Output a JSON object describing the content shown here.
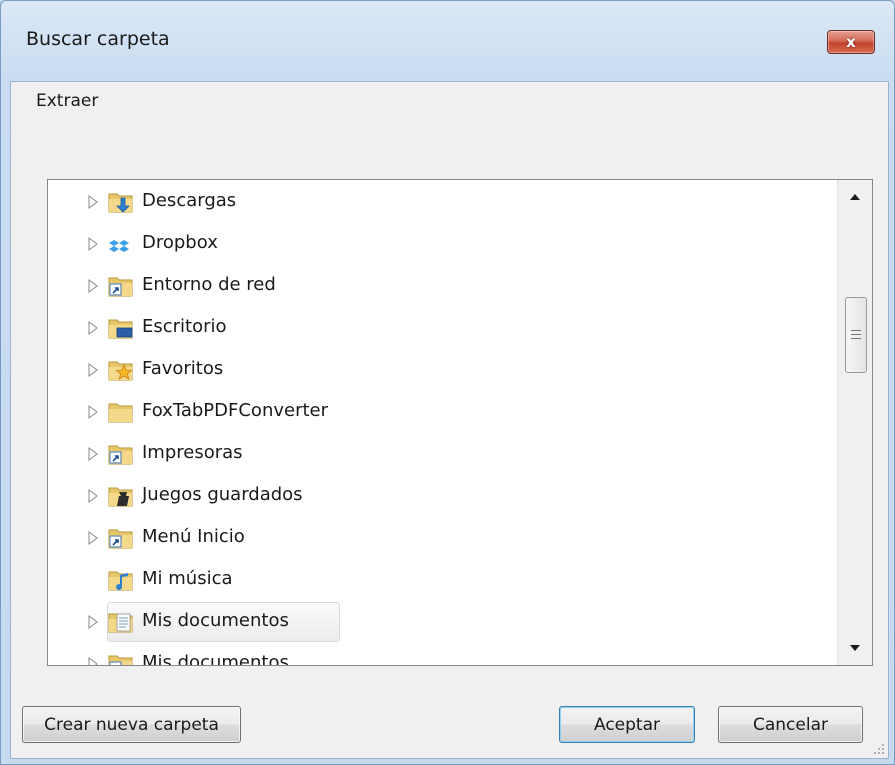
{
  "window": {
    "title": "Buscar carpeta",
    "close_label": "x"
  },
  "dialog": {
    "prompt": "Extraer"
  },
  "tree": {
    "items": [
      {
        "label": "Descargas",
        "icon": "downloads-folder-icon",
        "expandable": true
      },
      {
        "label": "Dropbox",
        "icon": "dropbox-folder-icon",
        "expandable": true
      },
      {
        "label": "Entorno de red",
        "icon": "shortcut-folder-icon",
        "expandable": true
      },
      {
        "label": "Escritorio",
        "icon": "desktop-folder-icon",
        "expandable": true
      },
      {
        "label": "Favoritos",
        "icon": "favorites-folder-icon",
        "expandable": true
      },
      {
        "label": "FoxTabPDFConverter",
        "icon": "folder-icon",
        "expandable": true
      },
      {
        "label": "Impresoras",
        "icon": "shortcut-folder-icon",
        "expandable": true
      },
      {
        "label": "Juegos guardados",
        "icon": "saved-games-folder-icon",
        "expandable": true
      },
      {
        "label": "Menú Inicio",
        "icon": "shortcut-folder-icon",
        "expandable": true
      },
      {
        "label": "Mi música",
        "icon": "music-folder-icon",
        "expandable": false
      },
      {
        "label": "Mis documentos",
        "icon": "documents-folder-icon",
        "expandable": true,
        "selected": true
      },
      {
        "label": "Mis documentos",
        "icon": "shortcut-folder-icon",
        "expandable": true
      }
    ]
  },
  "buttons": {
    "new_folder": "Crear nueva carpeta",
    "ok": "Aceptar",
    "cancel": "Cancelar"
  }
}
